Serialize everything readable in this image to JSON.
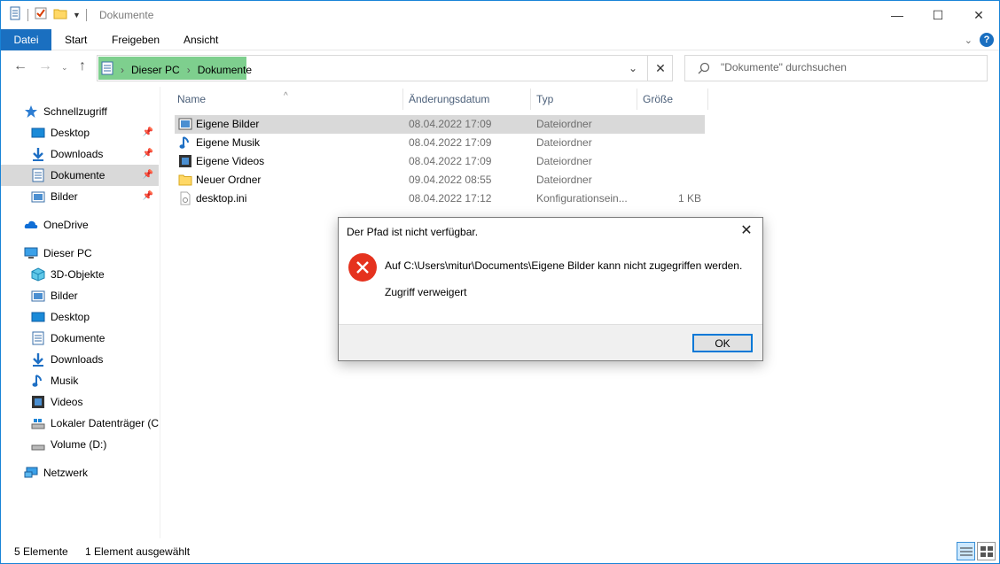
{
  "window": {
    "title": "Dokumente",
    "controls": {
      "minimize": "—",
      "maximize": "☐",
      "close": "✕"
    }
  },
  "ribbon": {
    "tabs": [
      {
        "label": "Datei"
      },
      {
        "label": "Start"
      },
      {
        "label": "Freigeben"
      },
      {
        "label": "Ansicht"
      }
    ]
  },
  "address": {
    "crumbs": [
      "Dieser PC",
      "Dokumente"
    ],
    "separator": "›"
  },
  "search": {
    "placeholder": "\"Dokumente\" durchsuchen"
  },
  "sidebar": {
    "items": [
      {
        "label": "Schnellzugriff",
        "icon": "star-icon",
        "pinned": false
      },
      {
        "label": "Desktop",
        "icon": "desktop-icon",
        "pinned": true
      },
      {
        "label": "Downloads",
        "icon": "download-icon",
        "pinned": true
      },
      {
        "label": "Dokumente",
        "icon": "document-icon",
        "pinned": true,
        "selected": true
      },
      {
        "label": "Bilder",
        "icon": "pictures-icon",
        "pinned": true
      },
      {
        "label": "OneDrive",
        "icon": "cloud-icon",
        "pinned": false
      },
      {
        "label": "Dieser PC",
        "icon": "computer-icon",
        "pinned": false
      },
      {
        "label": "3D-Objekte",
        "icon": "cube-icon",
        "pinned": false
      },
      {
        "label": "Bilder",
        "icon": "pictures-icon",
        "pinned": false
      },
      {
        "label": "Desktop",
        "icon": "desktop-icon",
        "pinned": false
      },
      {
        "label": "Dokumente",
        "icon": "document-icon",
        "pinned": false
      },
      {
        "label": "Downloads",
        "icon": "download-icon",
        "pinned": false
      },
      {
        "label": "Musik",
        "icon": "music-icon",
        "pinned": false
      },
      {
        "label": "Videos",
        "icon": "video-icon",
        "pinned": false
      },
      {
        "label": "Lokaler Datenträger (C:)",
        "icon": "drive-icon",
        "pinned": false
      },
      {
        "label": "Volume (D:)",
        "icon": "drive-icon",
        "pinned": false
      },
      {
        "label": "Netzwerk",
        "icon": "network-icon",
        "pinned": false
      }
    ]
  },
  "list": {
    "columns": [
      "Name",
      "Änderungsdatum",
      "Typ",
      "Größe"
    ],
    "rows": [
      {
        "name": "Eigene Bilder",
        "date": "08.04.2022 17:09",
        "type": "Dateiordner",
        "size": "",
        "icon": "pictures-folder-icon",
        "selected": true
      },
      {
        "name": "Eigene Musik",
        "date": "08.04.2022 17:09",
        "type": "Dateiordner",
        "size": "",
        "icon": "music-folder-icon"
      },
      {
        "name": "Eigene Videos",
        "date": "08.04.2022 17:09",
        "type": "Dateiordner",
        "size": "",
        "icon": "video-folder-icon"
      },
      {
        "name": "Neuer Ordner",
        "date": "09.04.2022 08:55",
        "type": "Dateiordner",
        "size": "",
        "icon": "folder-icon"
      },
      {
        "name": "desktop.ini",
        "date": "08.04.2022 17:12",
        "type": "Konfigurationsein...",
        "size": "1 KB",
        "icon": "settings-file-icon"
      }
    ]
  },
  "status": {
    "count": "5 Elemente",
    "selection": "1 Element ausgewählt"
  },
  "dialog": {
    "title": "Der Pfad ist nicht verfügbar.",
    "message": "Auf C:\\Users\\mitur\\Documents\\Eigene Bilder kann nicht zugegriffen werden.",
    "detail": "Zugriff verweigert",
    "ok_label": "OK",
    "icon": "error-icon",
    "error_color": "#e5321e"
  },
  "colors": {
    "accent": "#1a6fc0",
    "address_highlight": "#7ecf8e",
    "selection": "#d9d9d9"
  }
}
